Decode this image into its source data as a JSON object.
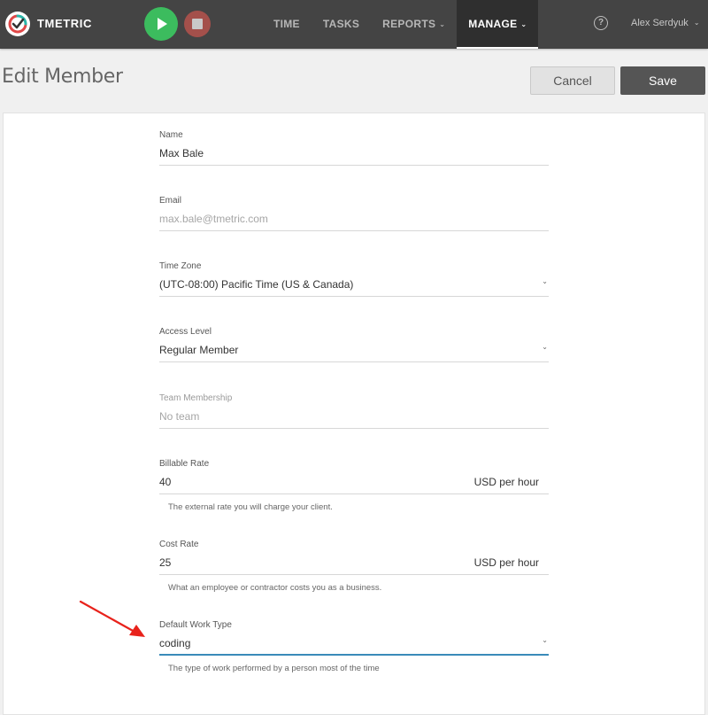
{
  "app": {
    "name": "TMETRIC",
    "colors": {
      "topbar": "#444444",
      "play": "#3cbc5e",
      "stop": "#a4504b",
      "accent": "#3a8bb9",
      "annotation": "#e8221b"
    }
  },
  "topbar": {
    "nav": [
      {
        "label": "TIME"
      },
      {
        "label": "TASKS"
      },
      {
        "label": "REPORTS"
      },
      {
        "label": "MANAGE"
      }
    ],
    "help_label": "?",
    "user_name": "Alex Serdyuk"
  },
  "page": {
    "title": "Edit Member",
    "cancel_label": "Cancel",
    "save_label": "Save"
  },
  "form": {
    "name": {
      "label": "Name",
      "value": "Max Bale"
    },
    "email": {
      "label": "Email",
      "value": "max.bale@tmetric.com"
    },
    "time_zone": {
      "label": "Time Zone",
      "value": "(UTC-08:00) Pacific Time (US & Canada)"
    },
    "access_level": {
      "label": "Access Level",
      "value": "Regular Member"
    },
    "team_membership": {
      "label": "Team Membership",
      "value": "No team"
    },
    "billable_rate": {
      "label": "Billable Rate",
      "value": "40",
      "unit": "USD per hour",
      "hint": "The external rate you will charge your client."
    },
    "cost_rate": {
      "label": "Cost Rate",
      "value": "25",
      "unit": "USD per hour",
      "hint": "What an employee or contractor costs you as a business."
    },
    "default_work_type": {
      "label": "Default Work Type",
      "value": "coding",
      "hint": "The type of work performed by a person most of the time"
    }
  }
}
